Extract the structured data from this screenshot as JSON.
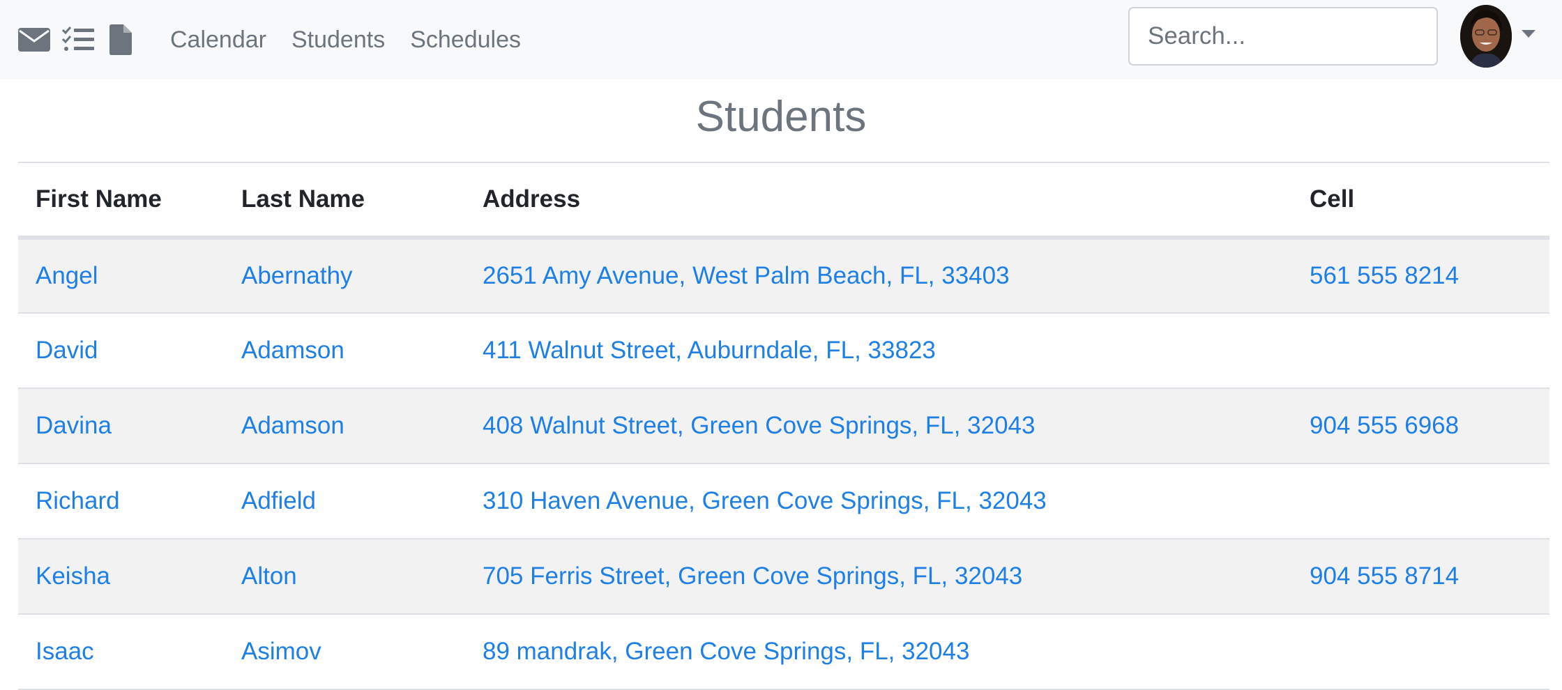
{
  "nav": {
    "icons": [
      "envelope-icon",
      "checklist-icon",
      "document-icon"
    ],
    "links": [
      {
        "label": "Calendar"
      },
      {
        "label": "Students"
      },
      {
        "label": "Schedules"
      }
    ],
    "search": {
      "placeholder": "Search...",
      "value": ""
    },
    "avatar": {
      "icon": "user-avatar"
    }
  },
  "page": {
    "title": "Students"
  },
  "table": {
    "columns": [
      "First Name",
      "Last Name",
      "Address",
      "Cell"
    ],
    "rows": [
      {
        "first": "Angel",
        "last": "Abernathy",
        "address": "2651 Amy Avenue, West Palm Beach, FL, 33403",
        "cell": "561 555 8214"
      },
      {
        "first": "David",
        "last": "Adamson",
        "address": "411 Walnut Street, Auburndale, FL, 33823",
        "cell": ""
      },
      {
        "first": "Davina",
        "last": "Adamson",
        "address": "408 Walnut Street, Green Cove Springs, FL, 32043",
        "cell": "904 555 6968"
      },
      {
        "first": "Richard",
        "last": "Adfield",
        "address": "310 Haven Avenue, Green Cove Springs, FL, 32043",
        "cell": ""
      },
      {
        "first": "Keisha",
        "last": "Alton",
        "address": "705 Ferris Street, Green Cove Springs, FL, 32043",
        "cell": "904 555 8714"
      },
      {
        "first": "Isaac",
        "last": "Asimov",
        "address": "89 mandrak, Green Cove Springs, FL, 32043",
        "cell": ""
      }
    ]
  },
  "colors": {
    "link": "#1e7fe6",
    "navbar_bg": "#f8f9fa",
    "muted_text": "#6c757d",
    "striped_row": "#f2f2f2"
  }
}
